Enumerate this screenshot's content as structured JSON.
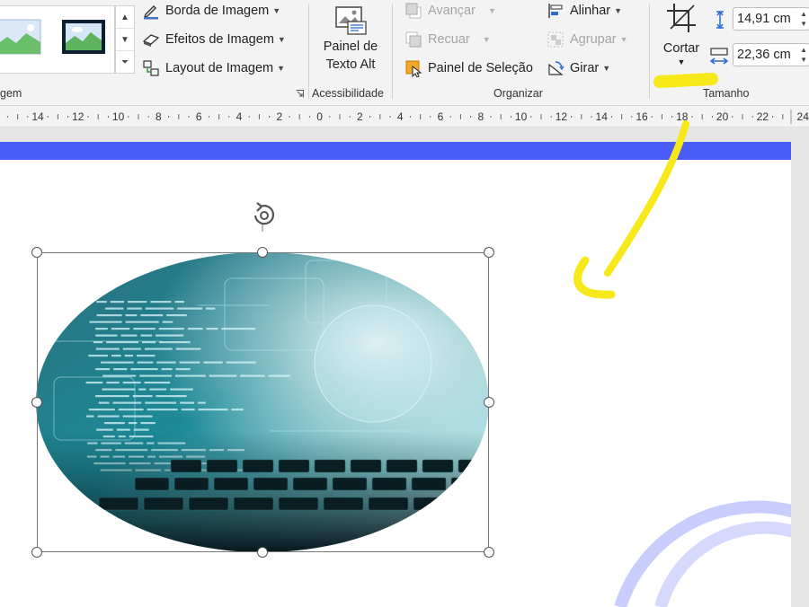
{
  "ribbon": {
    "styles_group_label": "gem",
    "picture_border": "Borda de Imagem",
    "picture_effects": "Efeitos de Imagem",
    "picture_layout": "Layout de Imagem",
    "alt_text_line1": "Painel de",
    "alt_text_line2": "Texto Alt",
    "accessibility_group": "Acessibilidade",
    "bring_forward": "Avançar",
    "send_backward": "Recuar",
    "selection_pane": "Painel de Seleção",
    "align": "Alinhar",
    "group": "Agrupar",
    "rotate": "Girar",
    "arrange_group": "Organizar",
    "crop": "Cortar",
    "height_value": "14,91 cm",
    "width_value": "22,36 cm",
    "size_group": "Tamanho"
  },
  "ruler": {
    "labels": [
      "14",
      "12",
      "10",
      "8",
      "6",
      "4",
      "2",
      "0",
      "2",
      "4",
      "6",
      "8",
      "10",
      "12",
      "14",
      "16",
      "18",
      "20",
      "22",
      "24"
    ]
  },
  "colors": {
    "slide_bar": "#4a5cf7",
    "annotation": "#f7e81a",
    "image_tint": "#1d8a97"
  }
}
